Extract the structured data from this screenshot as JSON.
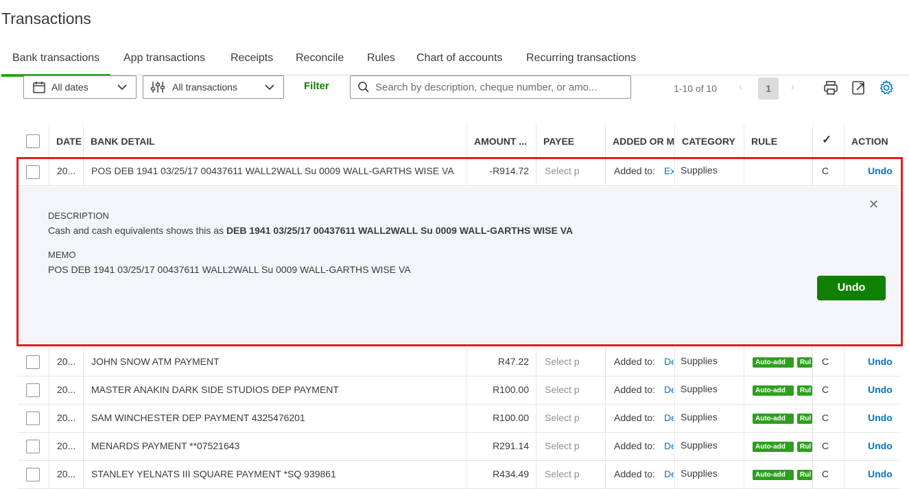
{
  "page": {
    "title": "Transactions"
  },
  "tabs": [
    {
      "label": "Bank transactions",
      "active": true
    },
    {
      "label": "App transactions"
    },
    {
      "label": "Receipts"
    },
    {
      "label": "Reconcile"
    },
    {
      "label": "Rules"
    },
    {
      "label": "Chart of accounts"
    },
    {
      "label": "Recurring transactions"
    }
  ],
  "toolbar": {
    "dates": "All dates",
    "transactions": "All transactions",
    "filter": "Filter",
    "search_placeholder": "Search by description, cheque number, or amo...",
    "pager": "1-10 of 10",
    "page": "1"
  },
  "columns": {
    "date": "DATE",
    "bank_detail": "BANK DETAIL",
    "amount": "AMOUNT ...",
    "payee": "PAYEE",
    "added": "ADDED OR M",
    "category": "CATEGORY",
    "rule": "RULE",
    "check": "✓",
    "action": "ACTION"
  },
  "expanded_row": {
    "date": "20...",
    "detail": "POS DEB 1941 03/25/17 00437611 WALL2WALL Su 0009 WALL-GARTHS WISE VA",
    "amount": "-R914.72",
    "payee": "Select p",
    "added_prefix": "Added to:",
    "added_link": "Ex",
    "category": "Supplies",
    "check": "C",
    "action": "Undo",
    "description_label": "DESCRIPTION",
    "description_prefix": "Cash and cash equivalents shows this as",
    "description_bold": "DEB 1941 03/25/17 00437611 WALL2WALL Su 0009 WALL-GARTHS WISE VA",
    "memo_label": "MEMO",
    "memo": "POS DEB 1941 03/25/17 00437611 WALL2WALL Su 0009 WALL-GARTHS WISE VA",
    "undo_button": "Undo"
  },
  "rows": [
    {
      "date": "20...",
      "detail": "JOHN SNOW ATM PAYMENT",
      "amount": "R47.22",
      "payee": "Select p",
      "added_prefix": "Added to:",
      "added_link": "De",
      "category": "Supplies",
      "badge1": "Auto-add",
      "badge2": "Rul",
      "check": "C",
      "action": "Undo"
    },
    {
      "date": "20...",
      "detail": "MASTER ANAKIN DARK SIDE STUDIOS DEP PAYMENT",
      "amount": "R100.00",
      "payee": "Select p",
      "added_prefix": "Added to:",
      "added_link": "De",
      "category": "Supplies",
      "badge1": "Auto-add",
      "badge2": "Rul",
      "check": "C",
      "action": "Undo"
    },
    {
      "date": "20...",
      "detail": "SAM WINCHESTER DEP PAYMENT 4325476201",
      "amount": "R100.00",
      "payee": "Select p",
      "added_prefix": "Added to:",
      "added_link": "De",
      "category": "Supplies",
      "badge1": "Auto-add",
      "badge2": "Rul",
      "check": "C",
      "action": "Undo"
    },
    {
      "date": "20...",
      "detail": "MENARDS PAYMENT **07521643",
      "amount": "R291.14",
      "payee": "Select p",
      "added_prefix": "Added to:",
      "added_link": "De",
      "category": "Supplies",
      "badge1": "Auto-add",
      "badge2": "Rul",
      "check": "C",
      "action": "Undo"
    },
    {
      "date": "20...",
      "detail": "STANLEY YELNATS III SQUARE PAYMENT *SQ 939861",
      "amount": "R434.49",
      "payee": "Select p",
      "added_prefix": "Added to:",
      "added_link": "De",
      "category": "Supplies",
      "badge1": "Auto-add",
      "badge2": "Rul",
      "check": "C",
      "action": "Undo"
    }
  ]
}
